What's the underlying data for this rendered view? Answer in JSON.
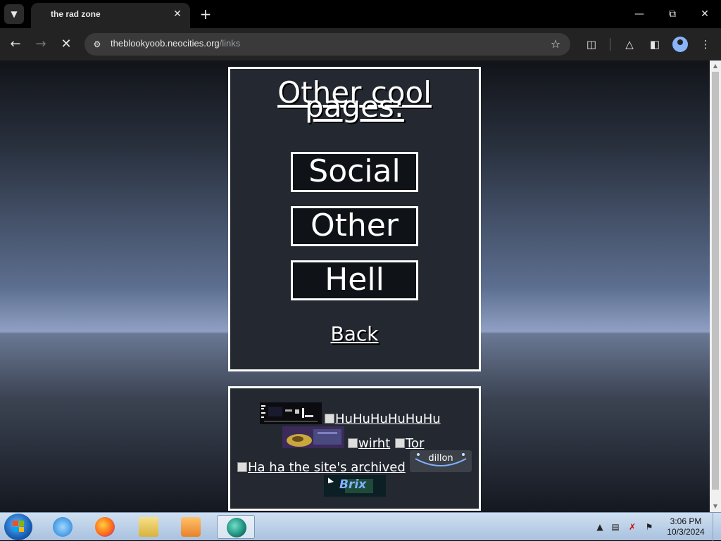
{
  "browser": {
    "tab_title": "the rad zone",
    "url_host": "theblookyoob.neocities.org",
    "url_path": "/links"
  },
  "page": {
    "heading": "Other cool pages:",
    "buttons": [
      {
        "label": "Social"
      },
      {
        "label": "Other"
      },
      {
        "label": "Hell"
      }
    ],
    "back_link": "Back",
    "badges": {
      "huhu_alt": "HuHuHuHuHuHu",
      "wirht_alt": "wirht",
      "tor_alt": "Tor",
      "archived_alt": "Ha ha the site's archived",
      "dillon_text": "dillon",
      "brix_text": "Brix"
    }
  },
  "taskbar": {
    "time": "3:06 PM",
    "date": "10/3/2024"
  },
  "colors": {
    "box_bg": "#232831",
    "border": "#ffffff",
    "button_bg": "#0f1317"
  }
}
